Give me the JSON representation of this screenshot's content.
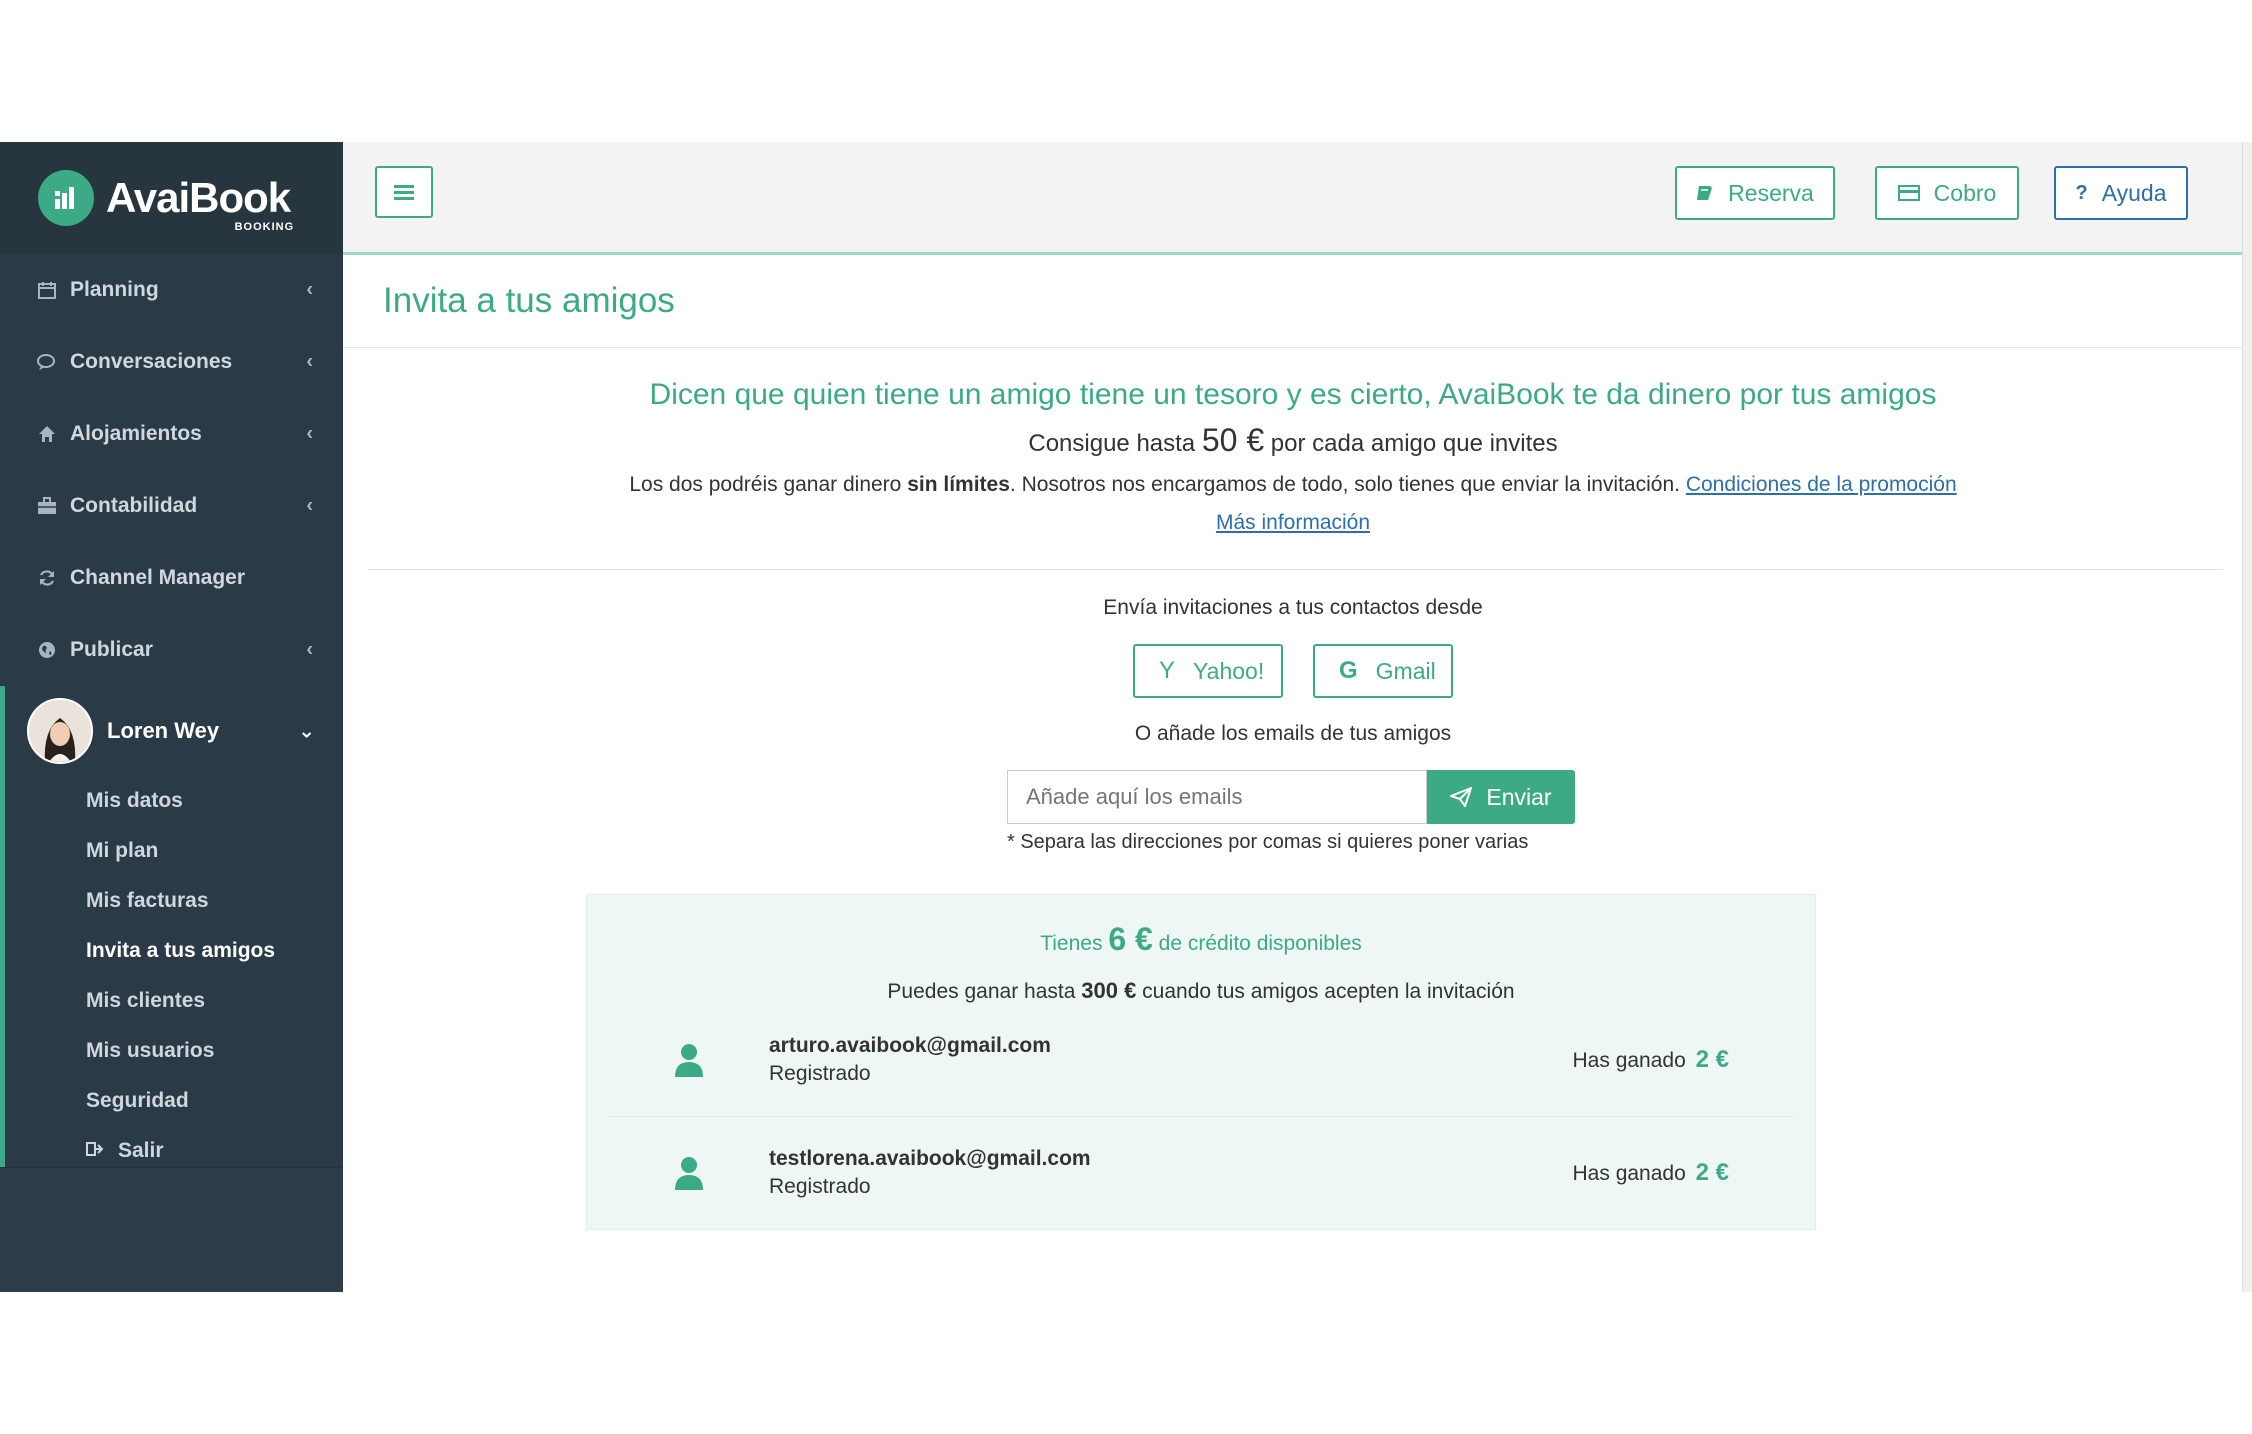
{
  "brand": {
    "name": "AvaiBook",
    "sub": "BOOKING"
  },
  "sidebar": {
    "items": [
      {
        "label": "Planning",
        "icon": "calendar-icon",
        "chevron": "‹"
      },
      {
        "label": "Conversaciones",
        "icon": "chat-icon",
        "chevron": "‹"
      },
      {
        "label": "Alojamientos",
        "icon": "home-icon",
        "chevron": "‹"
      },
      {
        "label": "Contabilidad",
        "icon": "briefcase-icon",
        "chevron": "‹"
      },
      {
        "label": "Channel Manager",
        "icon": "refresh-icon",
        "chevron": ""
      },
      {
        "label": "Publicar",
        "icon": "globe-icon",
        "chevron": "‹"
      }
    ],
    "user": {
      "name": "Loren Wey",
      "chevron": "⌄"
    },
    "subitems": [
      {
        "label": "Mis datos"
      },
      {
        "label": "Mi plan"
      },
      {
        "label": "Mis facturas"
      },
      {
        "label": "Invita a tus amigos"
      },
      {
        "label": "Mis clientes"
      },
      {
        "label": "Mis usuarios"
      },
      {
        "label": "Seguridad"
      },
      {
        "label": "Salir"
      }
    ]
  },
  "topbar": {
    "reserva": "Reserva",
    "cobro": "Cobro",
    "ayuda": "Ayuda",
    "ayuda_icon": "?"
  },
  "page": {
    "title": "Invita a tus amigos",
    "headline": "Dicen que quien tiene un amigo tiene un tesoro y es cierto, AvaiBook te da dinero por tus amigos",
    "sub1_pre": "Consigue hasta",
    "sub1_amount": "50 €",
    "sub1_post": "por cada amigo que invites",
    "sub2_pre": "Los dos podréis ganar dinero",
    "sub2_bold": "sin límites",
    "sub2_post": ". Nosotros nos encargamos de todo, solo tienes que enviar la invitación.",
    "conditions_link": "Condiciones de la promoción",
    "more_link": "Más información",
    "send_from": "Envía invitaciones a tus contactos desde",
    "yahoo": "Yahoo!",
    "yahoo_icon": "Y",
    "gmail": "Gmail",
    "gmail_icon": "G",
    "add_emails": "O añade los emails de tus amigos",
    "email_placeholder": "Añade aquí los emails",
    "send": "Enviar",
    "hint": "* Separa las direcciones por comas si quieres poner varias"
  },
  "credit": {
    "pre": "Tienes",
    "amount": "6 €",
    "post": "de crédito disponibles",
    "earn_pre": "Puedes ganar hasta",
    "earn_amount": "300 €",
    "earn_post": "cuando tus amigos acepten la invitación",
    "friends": [
      {
        "email": "arturo.avaibook@gmail.com",
        "status": "Registrado",
        "won_label": "Has ganado",
        "won_amount": "2 €"
      },
      {
        "email": "testlorena.avaibook@gmail.com",
        "status": "Registrado",
        "won_label": "Has ganado",
        "won_amount": "2 €"
      }
    ]
  },
  "colors": {
    "accent": "#3daa86",
    "sidebar": "#2b3a47",
    "link": "#2d6fa8"
  }
}
